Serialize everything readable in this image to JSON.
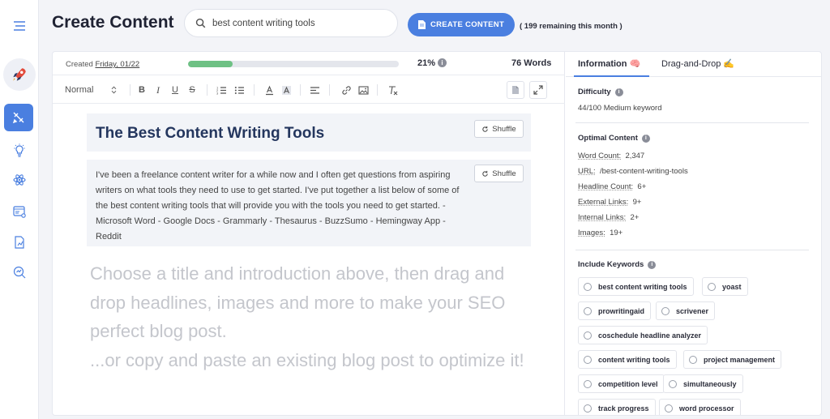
{
  "header": {
    "title": "Create Content",
    "search_value": "best content writing tools",
    "create_button": "CREATE CONTENT",
    "remaining": "( 199 remaining this month )"
  },
  "status": {
    "created_label": "Created",
    "created_date": "Friday, 01/22",
    "progress_percent": 21,
    "percent_label": "21%",
    "words_label": "76 Words"
  },
  "toolbar": {
    "format_select": "Normal",
    "buttons": [
      "bold",
      "italic",
      "underline",
      "strikethrough",
      "ordered-list",
      "bullet-list",
      "text-color",
      "highlight",
      "align",
      "link",
      "image",
      "clear-format"
    ]
  },
  "content": {
    "title": "The Best Content Writing Tools",
    "intro": "I've been a freelance content writer for a while now and I often get questions from aspiring writers on what tools they need to use to get started. I've put together a list below of some of the best content writing tools that will provide you with the tools you need to get started. - Microsoft Word - Google Docs - Grammarly - Thesaurus - BuzzSumo - Hemingway App - Reddit",
    "shuffle_label": "Shuffle",
    "placeholder_1": "Choose a title and introduction above, then drag and drop headlines, images and more to make your SEO perfect blog post.",
    "placeholder_2": "...or copy and paste an existing blog post to optimize it!"
  },
  "panel": {
    "tabs": [
      "Information 🧠",
      "Drag-and-Drop ✍️"
    ],
    "difficulty_label": "Difficulty",
    "difficulty_value": "44/100 Medium keyword",
    "optimal_label": "Optimal Content",
    "metrics": [
      {
        "k": "Word Count:",
        "v": "2,347"
      },
      {
        "k": "URL:",
        "v": "/best-content-writing-tools"
      },
      {
        "k": "Headline Count:",
        "v": "6+"
      },
      {
        "k": "External Links:",
        "v": "9+"
      },
      {
        "k": "Internal Links:",
        "v": "2+"
      },
      {
        "k": "Images:",
        "v": "19+"
      }
    ],
    "keywords_label": "Include Keywords",
    "keywords": [
      "best content writing tools",
      "yoast",
      "prowritingaid",
      "scrivener",
      "coschedule headline analyzer",
      "content writing tools",
      "project management",
      "competition level",
      "simultaneously",
      "track progress",
      "word processor"
    ]
  }
}
